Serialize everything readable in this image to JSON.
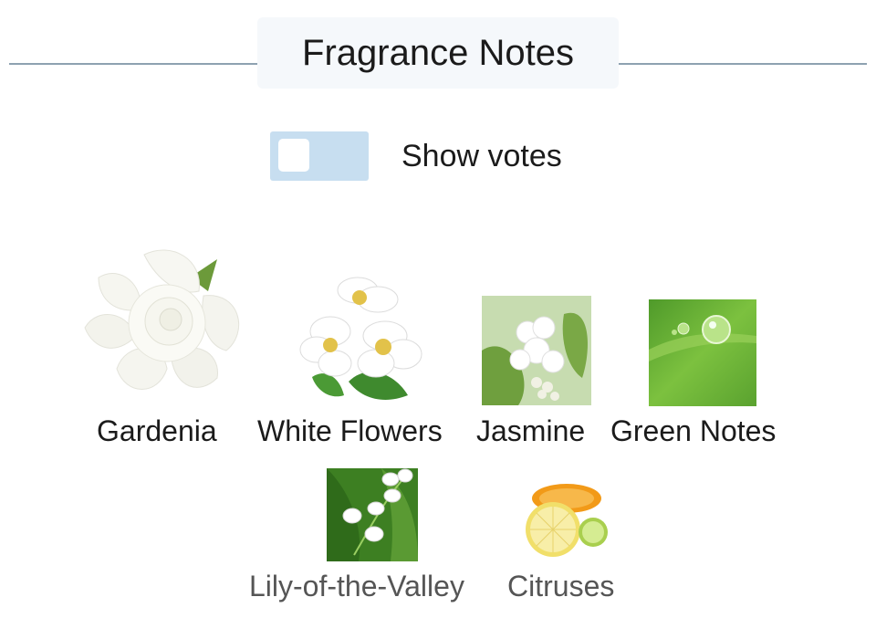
{
  "header": {
    "title": "Fragrance Notes"
  },
  "votes_toggle": {
    "label": "Show votes",
    "checked": false
  },
  "notes_row1": [
    {
      "name": "Gardenia",
      "icon": "gardenia-flower-image"
    },
    {
      "name": "White Flowers",
      "icon": "white-flowers-image"
    },
    {
      "name": "Jasmine",
      "icon": "jasmine-image"
    },
    {
      "name": "Green Notes",
      "icon": "green-leaf-dewdrop-image"
    }
  ],
  "notes_row2": [
    {
      "name": "Lily-of-the-Valley",
      "icon": "lily-of-the-valley-image"
    },
    {
      "name": "Citruses",
      "icon": "citrus-slices-image"
    }
  ],
  "colors": {
    "divider": "#8ea2b1",
    "title_bg": "#f5f8fb",
    "toggle_track": "#c7def0",
    "label_dark": "#1b1b1b",
    "label_muted": "#555555"
  }
}
